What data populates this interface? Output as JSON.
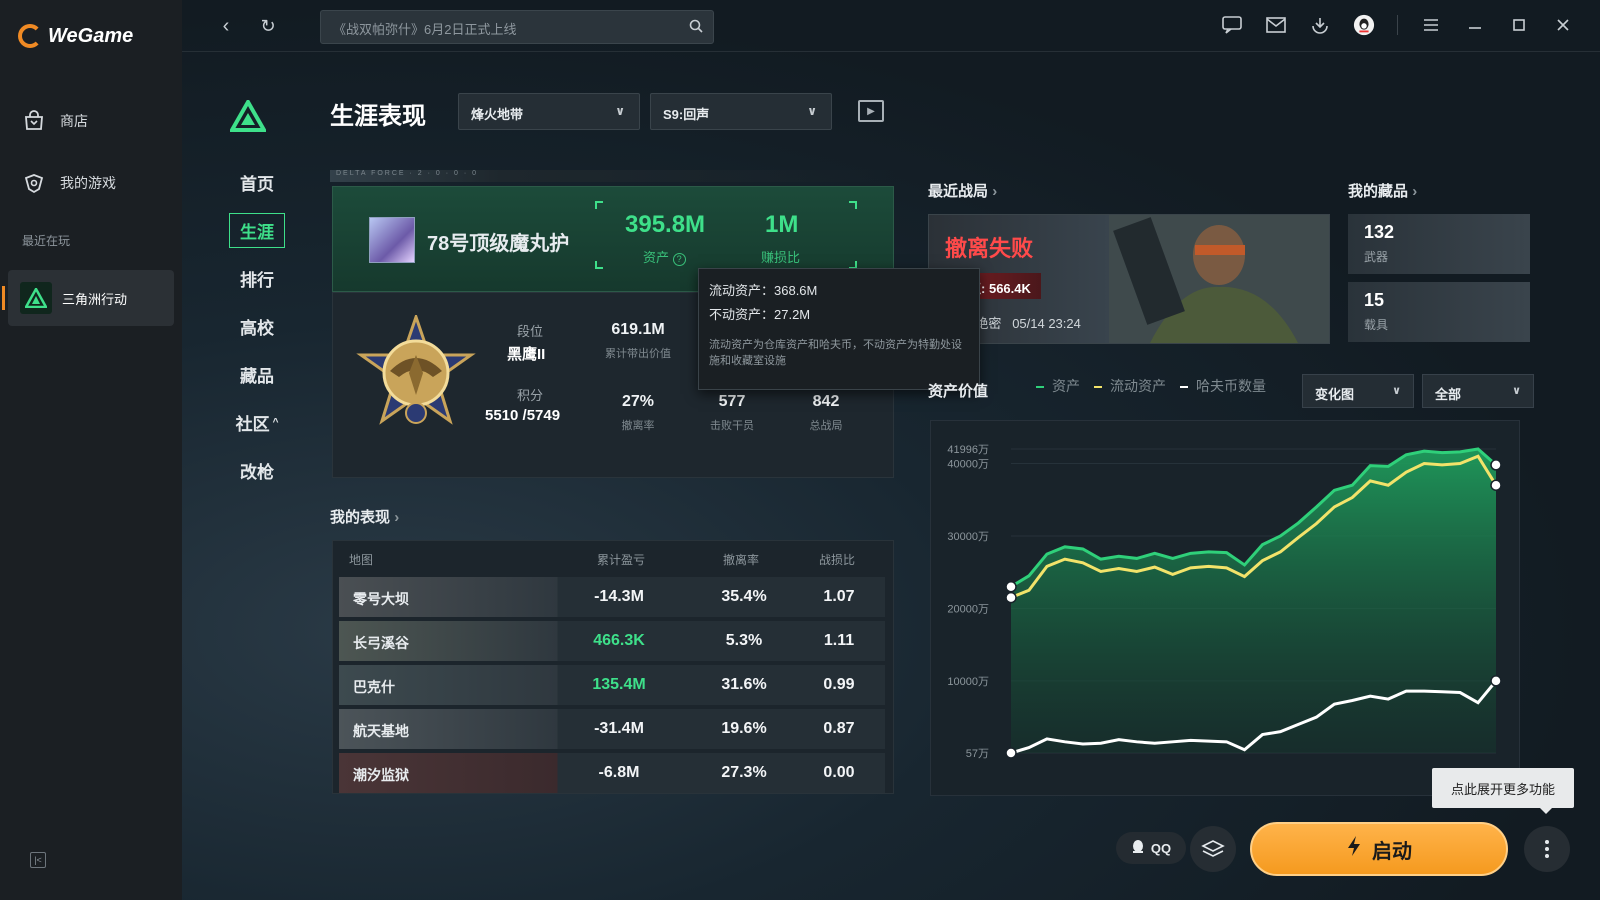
{
  "app": {
    "name": "WeGame"
  },
  "sidebar": {
    "items": [
      {
        "label": "商店",
        "icon": "bag-icon"
      },
      {
        "label": "我的游戏",
        "icon": "gamepad-icon"
      }
    ],
    "recent_label": "最近在玩",
    "recent_game": "三角洲行动"
  },
  "topbar": {
    "search_placeholder": "《战双帕弥什》6月2日正式上线"
  },
  "game_nav": {
    "items": [
      "首页",
      "生涯",
      "排行",
      "高校",
      "藏品",
      "社区",
      "改枪"
    ],
    "active": "生涯"
  },
  "page": {
    "title": "生涯表现",
    "mode_dropdown": "烽火地带",
    "season_dropdown": "S9:回声"
  },
  "profile": {
    "strip_text": "DELTA FORCE · 2 · 0 · 0 · 0",
    "name": "78号顶级魔丸护",
    "assets_value": "395.8M",
    "assets_label": "资产",
    "ratio_value": "1M",
    "ratio_label": "赚损比",
    "rank_label": "段位",
    "rank_value": "黑鹰II",
    "score_label": "积分",
    "score_value": "5510 /5749",
    "stats": [
      {
        "value": "619.1M",
        "label": "累计带出价值"
      },
      {
        "value": "27%",
        "label": "撤离率"
      },
      {
        "value": "577",
        "label": "击败干员"
      },
      {
        "value": "842",
        "label": "总战局"
      }
    ]
  },
  "tooltip": {
    "liquid": "流动资产：368.6M",
    "fixed": "不动资产：27.2M",
    "note": "流动资产为仓库资产和哈夫币，不动资产为特勤处设施和收藏室设施"
  },
  "performance": {
    "title": "我的表现",
    "headers": [
      "地图",
      "累计盈亏",
      "撤离率",
      "战损比"
    ],
    "rows": [
      {
        "map": "零号大坝",
        "pnl": "-14.3M",
        "rate": "35.4%",
        "kd": "1.07",
        "positive": false
      },
      {
        "map": "长弓溪谷",
        "pnl": "466.3K",
        "rate": "5.3%",
        "kd": "1.11",
        "positive": true
      },
      {
        "map": "巴克什",
        "pnl": "135.4M",
        "rate": "31.6%",
        "kd": "0.99",
        "positive": true
      },
      {
        "map": "航天基地",
        "pnl": "-31.4M",
        "rate": "19.6%",
        "kd": "0.87",
        "positive": false
      },
      {
        "map": "潮汐监狱",
        "pnl": "-6.8M",
        "rate": "27.3%",
        "kd": "0.00",
        "positive": false
      }
    ]
  },
  "recent_match": {
    "title": "最近战局",
    "result": "撤离失败",
    "value_label": "价值:",
    "value": "566.4K",
    "location": "基地-绝密",
    "time": "05/14 23:24"
  },
  "collection": {
    "title": "我的藏品",
    "items": [
      {
        "count": "132",
        "label": "武器"
      },
      {
        "count": "15",
        "label": "载具"
      }
    ]
  },
  "asset_chart": {
    "title": "资产价值",
    "legend": [
      "资产",
      "流动资产",
      "哈夫币数量"
    ],
    "view_dropdown": "变化图",
    "range_dropdown": "全部"
  },
  "chart_data": {
    "type": "area",
    "title": "资产价值",
    "y_ticks": [
      "41996万",
      "40000万",
      "30000万",
      "20000万",
      "10000万",
      "57万"
    ],
    "ylim": [
      57,
      41996
    ],
    "grid": true,
    "legend_position": "top-right",
    "series": [
      {
        "name": "资产",
        "color": "#2fd07a",
        "values": [
          23000,
          24500,
          27500,
          28500,
          28200,
          26800,
          27200,
          26900,
          27600,
          26900,
          27600,
          27800,
          27700,
          26000,
          28800,
          30000,
          31800,
          34000,
          36300,
          37000,
          39700,
          39600,
          41200,
          41700,
          41500,
          41600,
          41996,
          39800
        ]
      },
      {
        "name": "流动资产",
        "color": "#f2e36a",
        "values": [
          21500,
          22500,
          25800,
          26800,
          26300,
          25100,
          25500,
          25100,
          25700,
          24700,
          25600,
          25800,
          25600,
          24400,
          26600,
          27800,
          29800,
          31700,
          34000,
          35300,
          37600,
          37000,
          38800,
          40000,
          39800,
          40000,
          41000,
          37000
        ]
      },
      {
        "name": "哈夫币数量",
        "color": "#ffffff",
        "values": [
          57,
          800,
          2000,
          1600,
          1300,
          1400,
          1900,
          1600,
          1400,
          1600,
          1800,
          1700,
          1600,
          500,
          2600,
          3000,
          4000,
          5000,
          6800,
          7300,
          7900,
          7500,
          8600,
          8600,
          8500,
          8400,
          7000,
          10000
        ]
      }
    ]
  },
  "bottom": {
    "qq_label": "QQ",
    "launch_label": "启动",
    "hint": "点此展开更多功能"
  },
  "colors": {
    "accent": "#3ee08a",
    "launch": "#f59a1f",
    "danger": "#ff4a4a"
  }
}
